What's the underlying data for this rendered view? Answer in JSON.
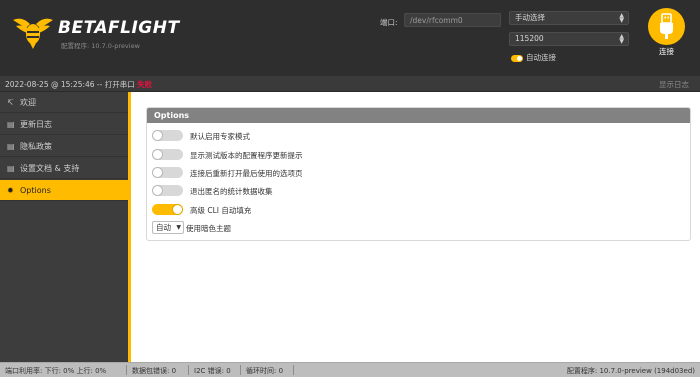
{
  "header": {
    "brand_beta": "BETA",
    "brand_flight": "FLIGHT",
    "configurator_version": "配置程序: 10.7.0-preview",
    "port_label": "端口:",
    "port_value": "/dev/rfcomm0",
    "port_select": "手动选择",
    "baud_select": "115200",
    "auto_connect": "自动连接",
    "connect_label": "连接",
    "accent_color": "#ffbb00"
  },
  "logbar": {
    "message": "2022-08-25 @ 15:25:46 -- 打开串口",
    "status": "失败",
    "show_log": "显示日志"
  },
  "sidebar": {
    "items": [
      {
        "label": "欢迎",
        "icon": "welcome-icon"
      },
      {
        "label": "更新日志",
        "icon": "changelog-icon"
      },
      {
        "label": "隐私政策",
        "icon": "privacy-icon"
      },
      {
        "label": "设置文档 & 支持",
        "icon": "help-icon"
      },
      {
        "label": "Options",
        "icon": "gear-icon",
        "active": true
      }
    ]
  },
  "options": {
    "title": "Options",
    "items": [
      {
        "label": "默认启用专家模式",
        "enabled": false
      },
      {
        "label": "显示测试版本的配置程序更新提示",
        "enabled": false
      },
      {
        "label": "连接后重新打开最后使用的选项页",
        "enabled": false
      },
      {
        "label": "退出匿名的统计数据收集",
        "enabled": false
      },
      {
        "label": "高级 CLI 自动填充",
        "enabled": true
      }
    ],
    "theme_value": "自动",
    "theme_label": "使用暗色主题"
  },
  "statusbar": {
    "port_usage": "端口利用率:  下行: 0% 上行: 0%",
    "packet_errors": "数据包错误: 0",
    "i2c_errors": "I2C 错误: 0",
    "cycle_time": "循环时间: 0",
    "version": "配置程序: 10.7.0-preview (194d03ed)"
  }
}
